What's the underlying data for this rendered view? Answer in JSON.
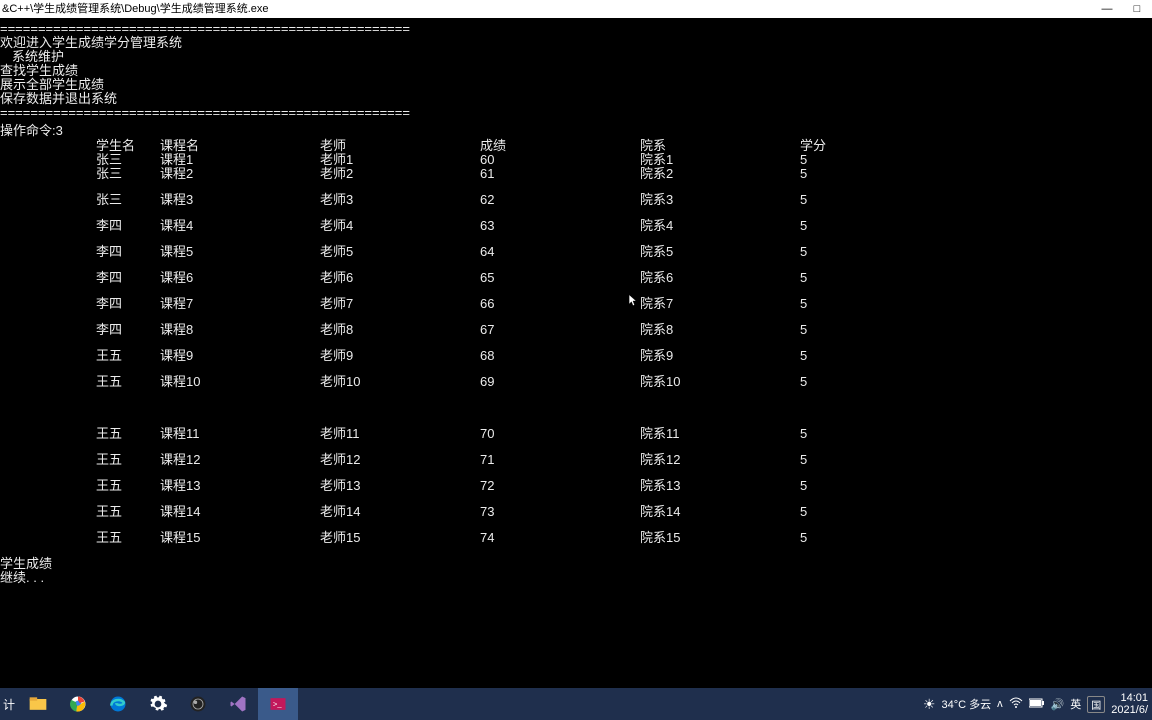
{
  "titlebar": {
    "path": "&C++\\学生成绩管理系统\\Debug\\学生成绩管理系统.exe"
  },
  "menu": {
    "welcome": "欢迎进入学生成绩学分管理系统",
    "items": [
      "系统维护",
      "查找学生成绩",
      "展示全部学生成绩",
      "保存数据并退出系统"
    ]
  },
  "divider": "======================================================",
  "prompt": "操作命令:3",
  "table": {
    "headers": [
      "学生名",
      "课程名",
      "老师",
      "成绩",
      "院系",
      "学分"
    ],
    "rows": [
      [
        "张三",
        "课程1",
        "老师1",
        "60",
        "院系1",
        "5"
      ],
      [
        "张三",
        "课程2",
        "老师2",
        "61",
        "院系2",
        "5"
      ],
      [
        "张三",
        "课程3",
        "老师3",
        "62",
        "院系3",
        "5"
      ],
      [
        "李四",
        "课程4",
        "老师4",
        "63",
        "院系4",
        "5"
      ],
      [
        "李四",
        "课程5",
        "老师5",
        "64",
        "院系5",
        "5"
      ],
      [
        "李四",
        "课程6",
        "老师6",
        "65",
        "院系6",
        "5"
      ],
      [
        "李四",
        "课程7",
        "老师7",
        "66",
        "院系7",
        "5"
      ],
      [
        "李四",
        "课程8",
        "老师8",
        "67",
        "院系8",
        "5"
      ],
      [
        "王五",
        "课程9",
        "老师9",
        "68",
        "院系9",
        "5"
      ],
      [
        "王五",
        "课程10",
        "老师10",
        "69",
        "院系10",
        "5"
      ],
      [
        "王五",
        "课程11",
        "老师11",
        "70",
        "院系11",
        "5"
      ],
      [
        "王五",
        "课程12",
        "老师12",
        "71",
        "院系12",
        "5"
      ],
      [
        "王五",
        "课程13",
        "老师13",
        "72",
        "院系13",
        "5"
      ],
      [
        "王五",
        "课程14",
        "老师14",
        "73",
        "院系14",
        "5"
      ],
      [
        "王五",
        "课程15",
        "老师15",
        "74",
        "院系15",
        "5"
      ]
    ],
    "gap_after_index": 9
  },
  "footer": {
    "line1": "学生成绩",
    "line2": "继续. . ."
  },
  "taskbar": {
    "weather": "34°C 多云",
    "ime": "英",
    "kb": "国",
    "time": "14:01",
    "date": "2021/6/"
  }
}
